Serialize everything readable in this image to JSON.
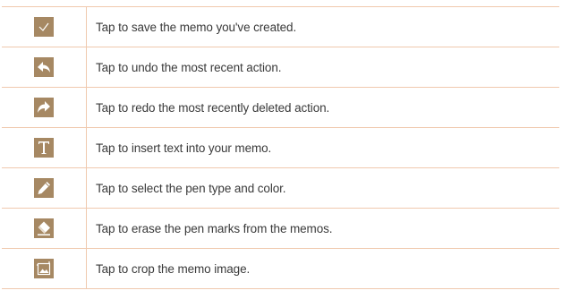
{
  "rows": [
    {
      "icon": "checkmark-icon",
      "text": "Tap to save the memo you've created."
    },
    {
      "icon": "undo-icon",
      "text": "Tap to undo the most recent action."
    },
    {
      "icon": "redo-icon",
      "text": "Tap to redo the most recently deleted action."
    },
    {
      "icon": "text-icon",
      "text": "Tap to insert text into your memo."
    },
    {
      "icon": "pen-icon",
      "text": "Tap to select the pen type and color."
    },
    {
      "icon": "eraser-icon",
      "text": "Tap to erase the pen marks from the memos."
    },
    {
      "icon": "crop-icon",
      "text": "Tap to crop the memo image."
    }
  ],
  "colors": {
    "icon_bg": "#a68863",
    "border": "#f0c9ae",
    "text": "#3a3a3a"
  }
}
